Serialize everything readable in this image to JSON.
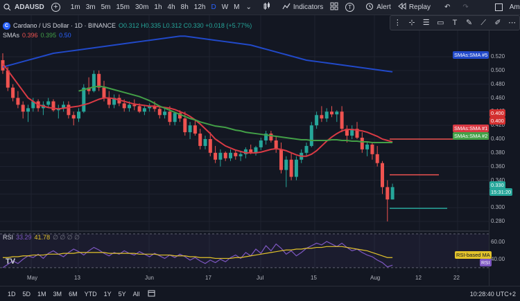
{
  "topbar": {
    "symbol": "ADAUSD",
    "intervals": [
      "1m",
      "3m",
      "5m",
      "15m",
      "30m",
      "1h",
      "4h",
      "8h",
      "12h",
      "D",
      "W",
      "M"
    ],
    "active_interval": "D",
    "indicators_label": "Indicators",
    "alert_label": "Alert",
    "replay_label": "Replay",
    "right_label": "Ama"
  },
  "legend": {
    "title": "Cardano / US Dollar · 1D · BINANCE",
    "symbol_badge": "C",
    "ohlc": "O0.312 H0.335 L0.312 C0.330 +0.018 (+5.77%)",
    "smas_label": "SMAs",
    "sma1": "0.396",
    "sma2": "0.395",
    "sma3": "0.50"
  },
  "price_axis": {
    "ticks": [
      "0.520",
      "0.500",
      "0.480",
      "0.460",
      "0.440",
      "0.420",
      "0.400",
      "0.380",
      "0.360",
      "0.340",
      "0.320",
      "0.300",
      "0.280"
    ],
    "tag_sma5": "SMAs:SMA #5",
    "tag_sma1": "SMAs:SMA #1",
    "tag_sma2": "SMAs:SMA #2",
    "tag_red1": "0.400",
    "tag_red2": "0.400",
    "tag_price": "0.330",
    "tag_countdown": "15:31:20"
  },
  "rsi": {
    "label": "RSI",
    "value1": "33.29",
    "value2": "41.78",
    "ticks": [
      "60.00",
      "40.00"
    ],
    "tag_ma": "RSI-based MA",
    "tag_rsi": "RSI"
  },
  "time_axis": {
    "labels": [
      "May",
      "13",
      "Jun",
      "17",
      "Jul",
      "15",
      "Aug",
      "12",
      "22"
    ]
  },
  "bottombar": {
    "ranges": [
      "1D",
      "5D",
      "1M",
      "3M",
      "6M",
      "YTD",
      "1Y",
      "5Y",
      "All"
    ],
    "clock": "10:28:40 UTC+2"
  },
  "logo": "TV",
  "colors": {
    "up": "#26a69a",
    "down": "#ef5350",
    "sma_blue": "#2149c9",
    "sma_red": "#d93a44",
    "sma_green": "#43a047",
    "rsi_line": "#7e57c2",
    "rsi_ma": "#e3c32b"
  },
  "chart_data": {
    "type": "candlestick",
    "title": "Cardano / US Dollar · 1D · BINANCE",
    "ylim": [
      0.27,
      0.54
    ],
    "candles": [
      [
        0.515,
        0.525,
        0.495,
        0.5
      ],
      [
        0.5,
        0.505,
        0.47,
        0.475
      ],
      [
        0.475,
        0.48,
        0.455,
        0.46
      ],
      [
        0.46,
        0.47,
        0.445,
        0.45
      ],
      [
        0.45,
        0.455,
        0.43,
        0.44
      ],
      [
        0.44,
        0.45,
        0.425,
        0.445
      ],
      [
        0.445,
        0.46,
        0.44,
        0.455
      ],
      [
        0.455,
        0.458,
        0.44,
        0.445
      ],
      [
        0.445,
        0.455,
        0.435,
        0.45
      ],
      [
        0.45,
        0.46,
        0.445,
        0.455
      ],
      [
        0.455,
        0.458,
        0.44,
        0.442
      ],
      [
        0.442,
        0.45,
        0.43,
        0.445
      ],
      [
        0.445,
        0.455,
        0.44,
        0.45
      ],
      [
        0.45,
        0.455,
        0.43,
        0.435
      ],
      [
        0.435,
        0.44,
        0.42,
        0.43
      ],
      [
        0.43,
        0.445,
        0.425,
        0.44
      ],
      [
        0.44,
        0.48,
        0.438,
        0.475
      ],
      [
        0.475,
        0.49,
        0.465,
        0.47
      ],
      [
        0.47,
        0.5,
        0.468,
        0.495
      ],
      [
        0.495,
        0.5,
        0.47,
        0.475
      ],
      [
        0.475,
        0.485,
        0.455,
        0.46
      ],
      [
        0.46,
        0.47,
        0.445,
        0.45
      ],
      [
        0.45,
        0.465,
        0.445,
        0.46
      ],
      [
        0.46,
        0.465,
        0.448,
        0.452
      ],
      [
        0.452,
        0.458,
        0.44,
        0.445
      ],
      [
        0.445,
        0.455,
        0.44,
        0.45
      ],
      [
        0.45,
        0.458,
        0.442,
        0.448
      ],
      [
        0.448,
        0.452,
        0.438,
        0.44
      ],
      [
        0.44,
        0.45,
        0.435,
        0.445
      ],
      [
        0.445,
        0.452,
        0.44,
        0.448
      ],
      [
        0.448,
        0.455,
        0.44,
        0.444
      ],
      [
        0.444,
        0.448,
        0.43,
        0.435
      ],
      [
        0.435,
        0.445,
        0.43,
        0.44
      ],
      [
        0.44,
        0.448,
        0.42,
        0.425
      ],
      [
        0.425,
        0.44,
        0.42,
        0.438
      ],
      [
        0.438,
        0.442,
        0.425,
        0.43
      ],
      [
        0.43,
        0.44,
        0.405,
        0.41
      ],
      [
        0.41,
        0.425,
        0.4,
        0.42
      ],
      [
        0.42,
        0.428,
        0.405,
        0.408
      ],
      [
        0.408,
        0.415,
        0.385,
        0.39
      ],
      [
        0.39,
        0.405,
        0.385,
        0.4
      ],
      [
        0.4,
        0.41,
        0.375,
        0.38
      ],
      [
        0.38,
        0.39,
        0.365,
        0.37
      ],
      [
        0.37,
        0.385,
        0.36,
        0.38
      ],
      [
        0.38,
        0.382,
        0.368,
        0.372
      ],
      [
        0.372,
        0.385,
        0.368,
        0.38
      ],
      [
        0.38,
        0.384,
        0.37,
        0.375
      ],
      [
        0.375,
        0.382,
        0.368,
        0.378
      ],
      [
        0.378,
        0.388,
        0.372,
        0.385
      ],
      [
        0.385,
        0.392,
        0.378,
        0.38
      ],
      [
        0.38,
        0.39,
        0.376,
        0.388
      ],
      [
        0.388,
        0.402,
        0.384,
        0.398
      ],
      [
        0.398,
        0.412,
        0.392,
        0.408
      ],
      [
        0.408,
        0.412,
        0.395,
        0.398
      ],
      [
        0.398,
        0.405,
        0.38,
        0.385
      ],
      [
        0.385,
        0.395,
        0.35,
        0.355
      ],
      [
        0.355,
        0.375,
        0.33,
        0.37
      ],
      [
        0.37,
        0.38,
        0.34,
        0.345
      ],
      [
        0.345,
        0.375,
        0.34,
        0.37
      ],
      [
        0.37,
        0.385,
        0.365,
        0.38
      ],
      [
        0.38,
        0.395,
        0.375,
        0.39
      ],
      [
        0.39,
        0.425,
        0.388,
        0.42
      ],
      [
        0.42,
        0.44,
        0.415,
        0.435
      ],
      [
        0.435,
        0.448,
        0.425,
        0.43
      ],
      [
        0.43,
        0.445,
        0.425,
        0.44
      ],
      [
        0.44,
        0.448,
        0.432,
        0.436
      ],
      [
        0.436,
        0.442,
        0.425,
        0.44
      ],
      [
        0.44,
        0.448,
        0.41,
        0.415
      ],
      [
        0.415,
        0.42,
        0.395,
        0.405
      ],
      [
        0.405,
        0.42,
        0.4,
        0.415
      ],
      [
        0.415,
        0.425,
        0.4,
        0.402
      ],
      [
        0.402,
        0.41,
        0.38,
        0.385
      ],
      [
        0.385,
        0.395,
        0.375,
        0.392
      ],
      [
        0.392,
        0.395,
        0.37,
        0.378
      ],
      [
        0.378,
        0.39,
        0.36,
        0.365
      ],
      [
        0.365,
        0.368,
        0.32,
        0.33
      ],
      [
        0.33,
        0.34,
        0.28,
        0.312
      ],
      [
        0.312,
        0.335,
        0.312,
        0.33
      ]
    ],
    "sma_blue": [
      0.505,
      0.507,
      0.509,
      0.511,
      0.513,
      0.515,
      0.517,
      0.519,
      0.521,
      0.523,
      0.525,
      0.526,
      0.527,
      0.528,
      0.529,
      0.53,
      0.531,
      0.532,
      0.533,
      0.534,
      0.535,
      0.536,
      0.537,
      0.538,
      0.539,
      0.54,
      0.541,
      0.542,
      0.543,
      0.544,
      0.545,
      0.546,
      0.547,
      0.548,
      0.549,
      0.55,
      0.55,
      0.549,
      0.548,
      0.547,
      0.546,
      0.545,
      0.544,
      0.543,
      0.542,
      0.541,
      0.54,
      0.539,
      0.538,
      0.537,
      0.535,
      0.533,
      0.531,
      0.529,
      0.527,
      0.525,
      0.523,
      0.521,
      0.519,
      0.517,
      0.515,
      0.514,
      0.513,
      0.512,
      0.511,
      0.51,
      0.509,
      0.508,
      0.507,
      0.506,
      0.505,
      0.504,
      0.503,
      0.502,
      0.501,
      0.5,
      0.499,
      0.498
    ],
    "sma_red": [
      0.51,
      0.5,
      0.49,
      0.48,
      0.47,
      0.46,
      0.455,
      0.45,
      0.448,
      0.446,
      0.445,
      0.444,
      0.445,
      0.446,
      0.447,
      0.448,
      0.45,
      0.452,
      0.455,
      0.458,
      0.46,
      0.46,
      0.459,
      0.457,
      0.455,
      0.453,
      0.451,
      0.45,
      0.449,
      0.448,
      0.448,
      0.447,
      0.446,
      0.445,
      0.443,
      0.44,
      0.437,
      0.433,
      0.428,
      0.422,
      0.415,
      0.408,
      0.4,
      0.395,
      0.39,
      0.387,
      0.384,
      0.382,
      0.38,
      0.38,
      0.38,
      0.381,
      0.383,
      0.385,
      0.386,
      0.385,
      0.383,
      0.38,
      0.377,
      0.375,
      0.375,
      0.378,
      0.383,
      0.39,
      0.397,
      0.403,
      0.408,
      0.412,
      0.414,
      0.414,
      0.413,
      0.412,
      0.41,
      0.407,
      0.404,
      0.4,
      0.398,
      0.396
    ],
    "sma_green": [
      null,
      null,
      null,
      null,
      null,
      null,
      null,
      null,
      null,
      null,
      null,
      null,
      null,
      null,
      null,
      0.47,
      0.472,
      0.474,
      0.476,
      0.477,
      0.476,
      0.474,
      0.472,
      0.47,
      0.468,
      0.466,
      0.464,
      0.462,
      0.459,
      0.456,
      0.452,
      0.448,
      0.445,
      0.442,
      0.439,
      0.436,
      0.433,
      0.43,
      0.428,
      0.425,
      0.423,
      0.421,
      0.419,
      0.418,
      0.417,
      0.415,
      0.413,
      0.412,
      0.41,
      0.409,
      0.408,
      0.407,
      0.406,
      0.405,
      0.404,
      0.403,
      0.402,
      0.401,
      0.4,
      0.399,
      0.399,
      0.398,
      0.398,
      0.398,
      0.398,
      0.399,
      0.399,
      0.398,
      0.398,
      0.397,
      0.397,
      0.396,
      0.396,
      0.395,
      0.395,
      0.395,
      0.395,
      0.395
    ],
    "hlines": [
      0.4,
      0.348,
      0.299
    ]
  }
}
